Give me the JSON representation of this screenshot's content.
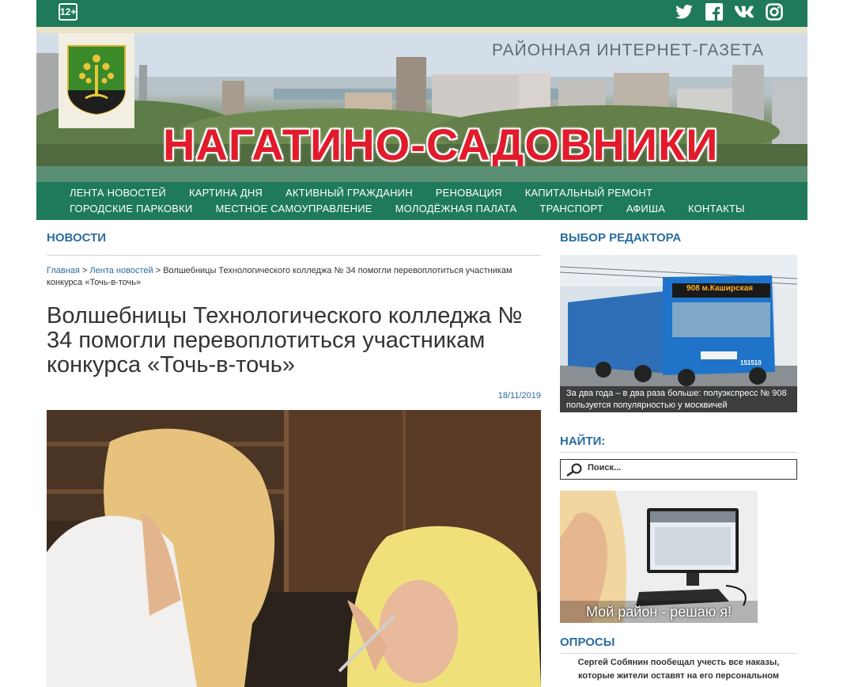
{
  "topbar": {
    "age_rating": "12+",
    "social": [
      "twitter-icon",
      "facebook-icon",
      "vk-icon",
      "instagram-icon"
    ]
  },
  "banner": {
    "tagline": "РАЙОННАЯ ИНТЕРНЕТ-ГАЗЕТА",
    "name": "НАГАТИНО-САДОВНИКИ"
  },
  "nav": {
    "row1": [
      "ЛЕНТА НОВОСТЕЙ",
      "КАРТИНА ДНЯ",
      "АКТИВНЫЙ ГРАЖДАНИН",
      "РЕНОВАЦИЯ",
      "КАПИТАЛЬНЫЙ РЕМОНТ"
    ],
    "row2": [
      "ГОРОДСКИЕ ПАРКОВКИ",
      "МЕСТНОЕ САМОУПРАВЛЕНИЕ",
      "МОЛОДЁЖНАЯ ПАЛАТА",
      "ТРАНСПОРТ",
      "АФИША",
      "КОНТАКТЫ"
    ]
  },
  "main": {
    "section_title": "НОВОСТИ",
    "breadcrumb": {
      "home": "Главная",
      "sep": " > ",
      "feed": "Лента новостей",
      "current": "Волшебницы Технологического колледжа № 34 помогли перевоплотиться участникам конкурса «Точь-в-точь»"
    },
    "headline": "Волшебницы Технологического колледжа № 34 помогли перевоплотиться участникам конкурса «Точь-в-точь»",
    "date": "18/11/2019"
  },
  "sidebar": {
    "editor_title": "ВЫБОР РЕДАКТОРА",
    "editor_caption": "За два года – в два раза больше: полуэкспресс № 908 пользуется популярностью у москвичей",
    "bus_route": "908",
    "bus_dest": "м.Каширская",
    "bus_number": "151510",
    "search_title": "НАЙТИ:",
    "search_placeholder": "Поиск...",
    "promo_caption": "Мой район - решаю я!",
    "polls_title": "ОПРОСЫ",
    "poll_text": "Сергей Собянин пообещал учесть все наказы, которые жители оставят на его персональном"
  }
}
